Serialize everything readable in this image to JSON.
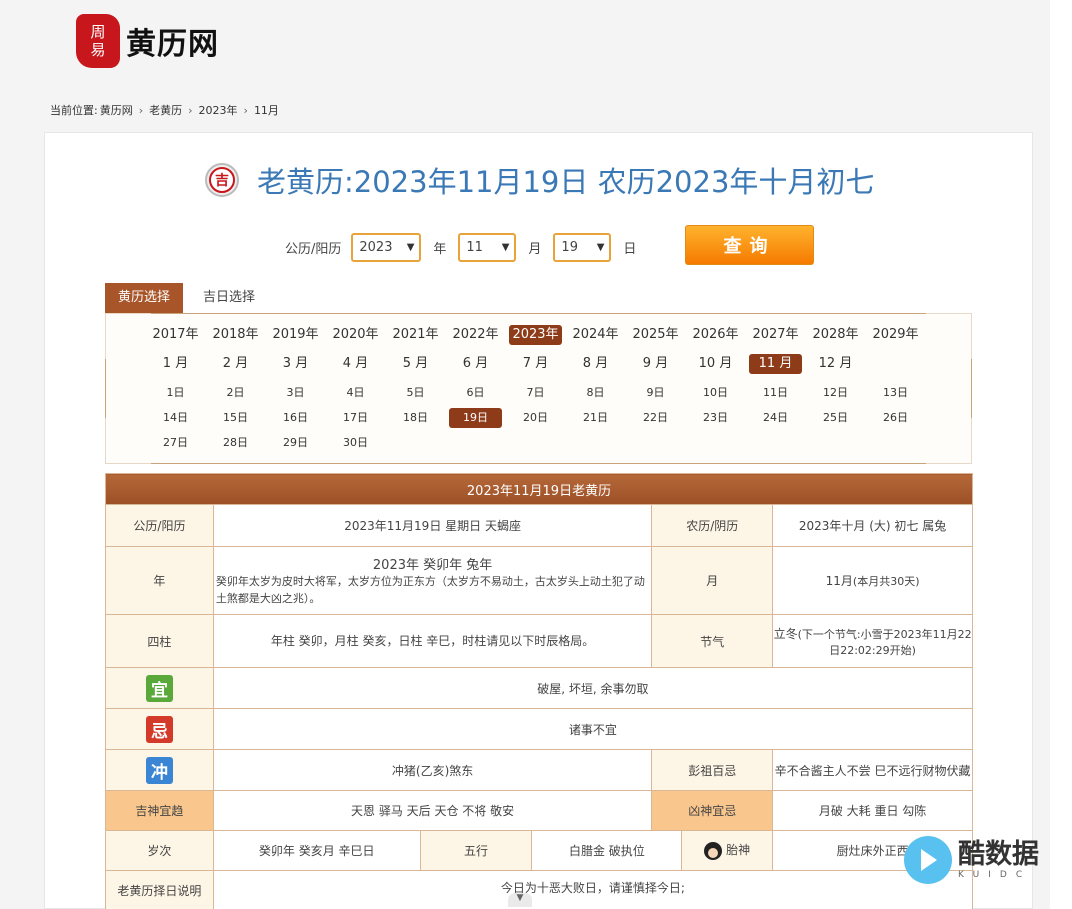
{
  "logo": {
    "seal_line1": "周",
    "seal_line2": "易",
    "text": "黄历网"
  },
  "breadcrumb": {
    "prefix": "当前位置:",
    "items": [
      "黄历网",
      "老黄历",
      "2023年",
      "11月"
    ]
  },
  "title": {
    "icon_char": "吉",
    "text": "老黄历:2023年11月19日 农历2023年十月初七"
  },
  "query": {
    "label": "公历/阳历",
    "year_value": "2023",
    "year_unit": "年",
    "month_value": "11",
    "month_unit": "月",
    "day_value": "19",
    "day_unit": "日",
    "button": "查询"
  },
  "tabs": [
    "黄历选择",
    "吉日选择"
  ],
  "years": [
    "2017年",
    "2018年",
    "2019年",
    "2020年",
    "2021年",
    "2022年",
    "2023年",
    "2024年",
    "2025年",
    "2026年",
    "2027年",
    "2028年",
    "2029年"
  ],
  "selected_year": "2023年",
  "months": [
    "1 月",
    "2 月",
    "3 月",
    "4 月",
    "5 月",
    "6 月",
    "7 月",
    "8 月",
    "9 月",
    "10 月",
    "11 月",
    "12 月"
  ],
  "selected_month": "11 月",
  "days": [
    "1日",
    "2日",
    "3日",
    "4日",
    "5日",
    "6日",
    "7日",
    "8日",
    "9日",
    "10日",
    "11日",
    "12日",
    "13日",
    "14日",
    "15日",
    "16日",
    "17日",
    "18日",
    "19日",
    "20日",
    "21日",
    "22日",
    "23日",
    "24日",
    "25日",
    "26日",
    "27日",
    "28日",
    "29日",
    "30日"
  ],
  "selected_day": "19日",
  "almanac": {
    "header": "2023年11月19日老黄历",
    "solar_label": "公历/阳历",
    "solar_value": "2023年11月19日 星期日 天蝎座",
    "lunar_label": "农历/阴历",
    "lunar_value": "2023年十月 (大) 初七 属兔",
    "year_label": "年",
    "year_title": "2023年 癸卯年 兔年",
    "year_desc": "癸卯年太岁为皮时大将军，太岁方位为正东方（太岁方不易动土，古太岁头上动土犯了动土煞都是大凶之兆）。",
    "month_label": "月",
    "month_value": "11月",
    "month_note": "(本月共30天)",
    "pillars_label": "四柱",
    "pillars_value": "年柱 癸卯，月柱 癸亥，日柱 辛巳，时柱请见以下时辰格局。",
    "solar_term_label": "节气",
    "solar_term_value": "立冬",
    "solar_term_note": "(下一个节气:小雪于2023年11月22日22:02:29开始)",
    "yi_badge": "宜",
    "yi_value": "破屋, 坏垣, 余事勿取",
    "ji_badge": "忌",
    "ji_value": "诸事不宜",
    "chong_badge": "冲",
    "chong_value": "冲猪(乙亥)煞东",
    "pengzu_label": "彭祖百忌",
    "pengzu_value": "辛不合酱主人不尝 巳不远行财物伏藏",
    "jishen_label": "吉神宜趋",
    "jishen_value": "天恩 驿马 天后 天仓 不将 敬安",
    "xiongshen_label": "凶神宜忌",
    "xiongshen_value": "月破 大耗 重日 勾陈",
    "suici_label": "岁次",
    "suici_value": "癸卯年 癸亥月 辛巳日",
    "wuxing_label": "五行",
    "wuxing_value": "白腊金 破执位",
    "taishen_label": "胎神",
    "taishen_value": "厨灶床外正西",
    "explain_label": "老黄历择日说明",
    "explain_value": "今日为十恶大败日，请谨慎择今日;"
  },
  "watermark": {
    "main": "酷数据",
    "sub": "KUIDC"
  }
}
